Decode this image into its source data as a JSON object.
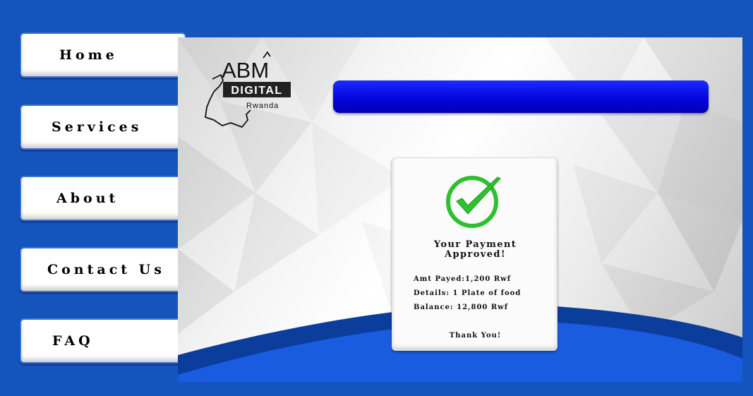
{
  "nav": {
    "home": "Home",
    "services": "Services",
    "about": "About",
    "contact": "Contact Us",
    "faq": "FAQ"
  },
  "logo": {
    "brand": "ABM",
    "digital": "DIGITAL",
    "country": "Rwanda"
  },
  "payment": {
    "title_line1": "Your Payment",
    "title_line2": "Approved!",
    "amount": "Amt Payed:1,200 Rwf",
    "details": "Details: 1 Plate of food",
    "balance": "Balance: 12,800 Rwf",
    "thanks": "Thank You!"
  },
  "colors": {
    "background": "#1553bd",
    "top_bar": "#0404d8",
    "check_green": "#2ec02e"
  },
  "icons": {
    "check": "check-circle-icon",
    "logo_map": "rwanda-map-outline-icon"
  }
}
